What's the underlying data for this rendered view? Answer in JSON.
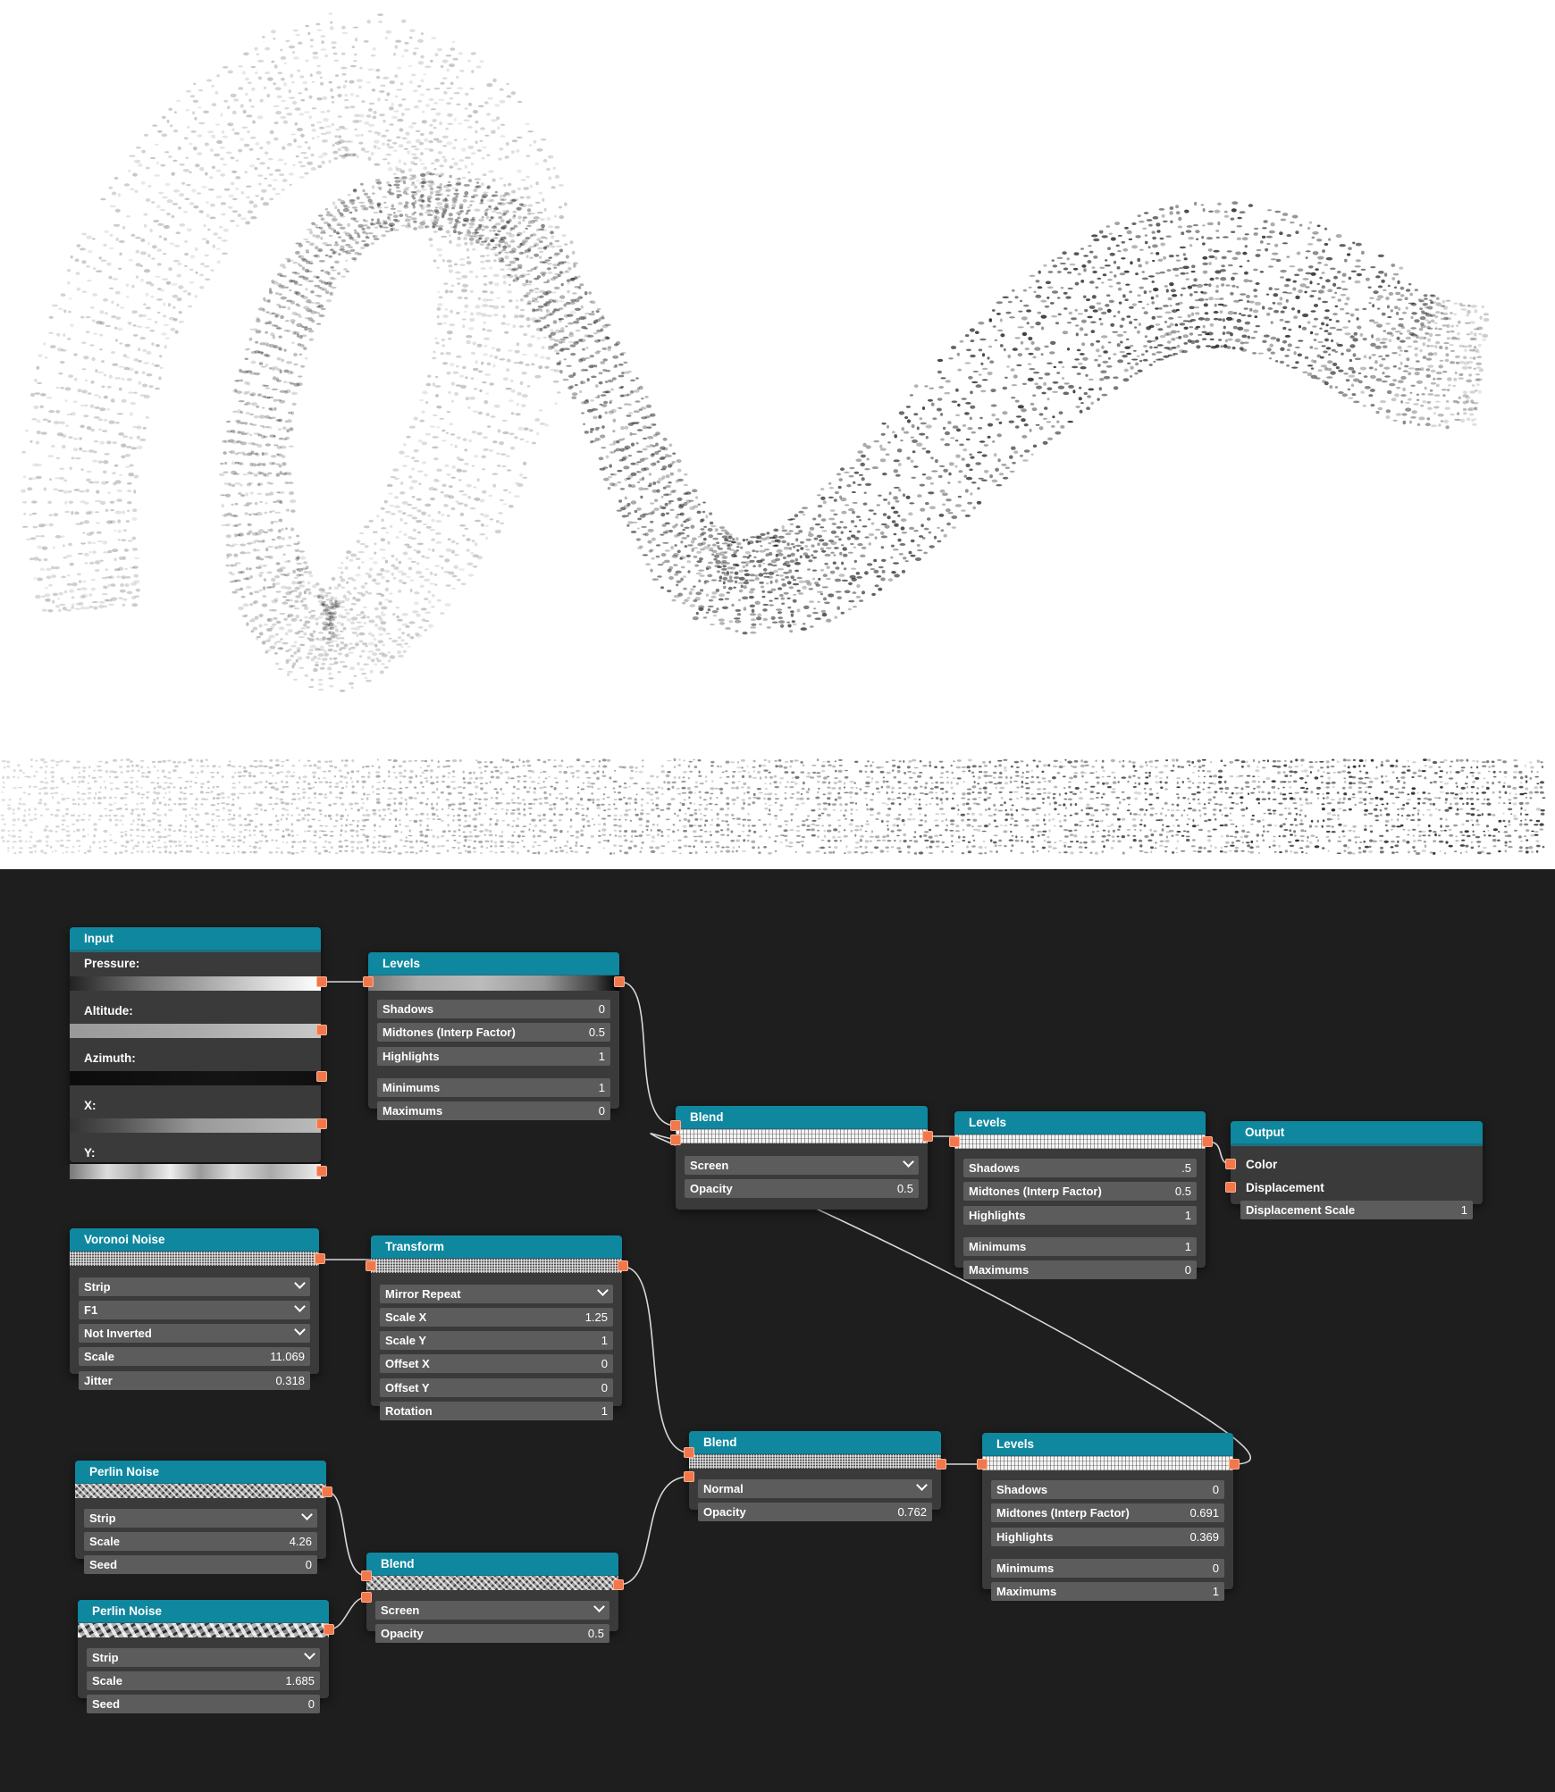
{
  "nodes": {
    "input": {
      "title": "Input",
      "labels": [
        "Pressure:",
        "Altitude:",
        "Azimuth:",
        "X:",
        "Y:"
      ]
    },
    "levels_1": {
      "title": "Levels",
      "rows": [
        {
          "label": "Shadows",
          "value": "0"
        },
        {
          "label": "Midtones (Interp Factor)",
          "value": "0.5"
        },
        {
          "label": "Highlights",
          "value": "1"
        },
        {
          "label": "Minimums",
          "value": "1"
        },
        {
          "label": "Maximums",
          "value": "0"
        }
      ]
    },
    "blend_1": {
      "title": "Blend",
      "mode": "Screen",
      "opacity_label": "Opacity",
      "opacity": "0.5"
    },
    "levels_2": {
      "title": "Levels",
      "rows": [
        {
          "label": "Shadows",
          "value": ".5"
        },
        {
          "label": "Midtones (Interp Factor)",
          "value": "0.5"
        },
        {
          "label": "Highlights",
          "value": "1"
        },
        {
          "label": "Minimums",
          "value": "1"
        },
        {
          "label": "Maximums",
          "value": "0"
        }
      ]
    },
    "output": {
      "title": "Output",
      "color_label": "Color",
      "displacement_label": "Displacement",
      "displacement_scale_label": "Displacement Scale",
      "displacement_scale": "1"
    },
    "voronoi": {
      "title": "Voronoi Noise",
      "dropdowns": [
        "Strip",
        "F1",
        "Not Inverted"
      ],
      "rows": [
        {
          "label": "Scale",
          "value": "11.069"
        },
        {
          "label": "Jitter",
          "value": "0.318"
        }
      ]
    },
    "transform": {
      "title": "Transform",
      "mode": "Mirror Repeat",
      "rows": [
        {
          "label": "Scale X",
          "value": "1.25"
        },
        {
          "label": "Scale Y",
          "value": "1"
        },
        {
          "label": "Offset X",
          "value": "0"
        },
        {
          "label": "Offset Y",
          "value": "0"
        },
        {
          "label": "Rotation",
          "value": "1"
        }
      ]
    },
    "blend_2": {
      "title": "Blend",
      "mode": "Normal",
      "opacity_label": "Opacity",
      "opacity": "0.762"
    },
    "levels_3": {
      "title": "Levels",
      "rows": [
        {
          "label": "Shadows",
          "value": "0"
        },
        {
          "label": "Midtones (Interp Factor)",
          "value": "0.691"
        },
        {
          "label": "Highlights",
          "value": "0.369"
        },
        {
          "label": "Minimums",
          "value": "0"
        },
        {
          "label": "Maximums",
          "value": "1"
        }
      ]
    },
    "perlin_1": {
      "title": "Perlin Noise",
      "mode": "Strip",
      "rows": [
        {
          "label": "Scale",
          "value": "4.26"
        },
        {
          "label": "Seed",
          "value": "0"
        }
      ]
    },
    "perlin_2": {
      "title": "Perlin Noise",
      "mode": "Strip",
      "rows": [
        {
          "label": "Scale",
          "value": "1.685"
        },
        {
          "label": "Seed",
          "value": "0"
        }
      ]
    },
    "blend_3": {
      "title": "Blend",
      "mode": "Screen",
      "opacity_label": "Opacity",
      "opacity": "0.5"
    }
  },
  "colors": {
    "header": "#0f879f",
    "socket": "#f2774b",
    "node_bg": "#3a3a3a",
    "field_bg": "#5c5c5c",
    "graph_bg": "#1e1e1e",
    "canvas_bg": "#ffffff"
  }
}
